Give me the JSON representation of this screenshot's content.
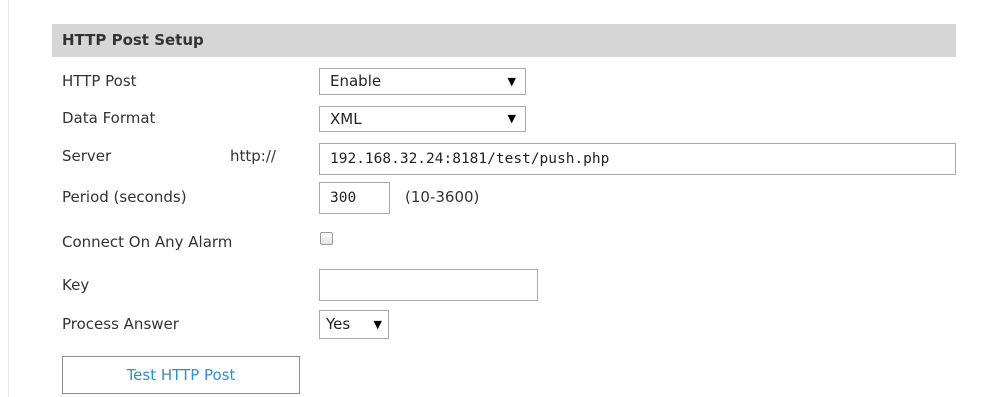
{
  "section": {
    "title": "HTTP Post Setup"
  },
  "fields": {
    "http_post": {
      "label": "HTTP Post",
      "value": "Enable",
      "arrow": "▼"
    },
    "data_format": {
      "label": "Data Format",
      "value": "XML",
      "arrow": "▼"
    },
    "server": {
      "label": "Server",
      "prefix": "http://",
      "value": "192.168.32.24:8181/test/push.php"
    },
    "period": {
      "label": "Period (seconds)",
      "value": "300",
      "hint": "(10-3600)"
    },
    "connect_on_any_alarm": {
      "label": "Connect On Any Alarm",
      "checked": false
    },
    "key": {
      "label": "Key",
      "value": ""
    },
    "process_answer": {
      "label": "Process Answer",
      "value": "Yes",
      "arrow": "▼"
    }
  },
  "buttons": {
    "test_http_post": "Test HTTP Post"
  }
}
